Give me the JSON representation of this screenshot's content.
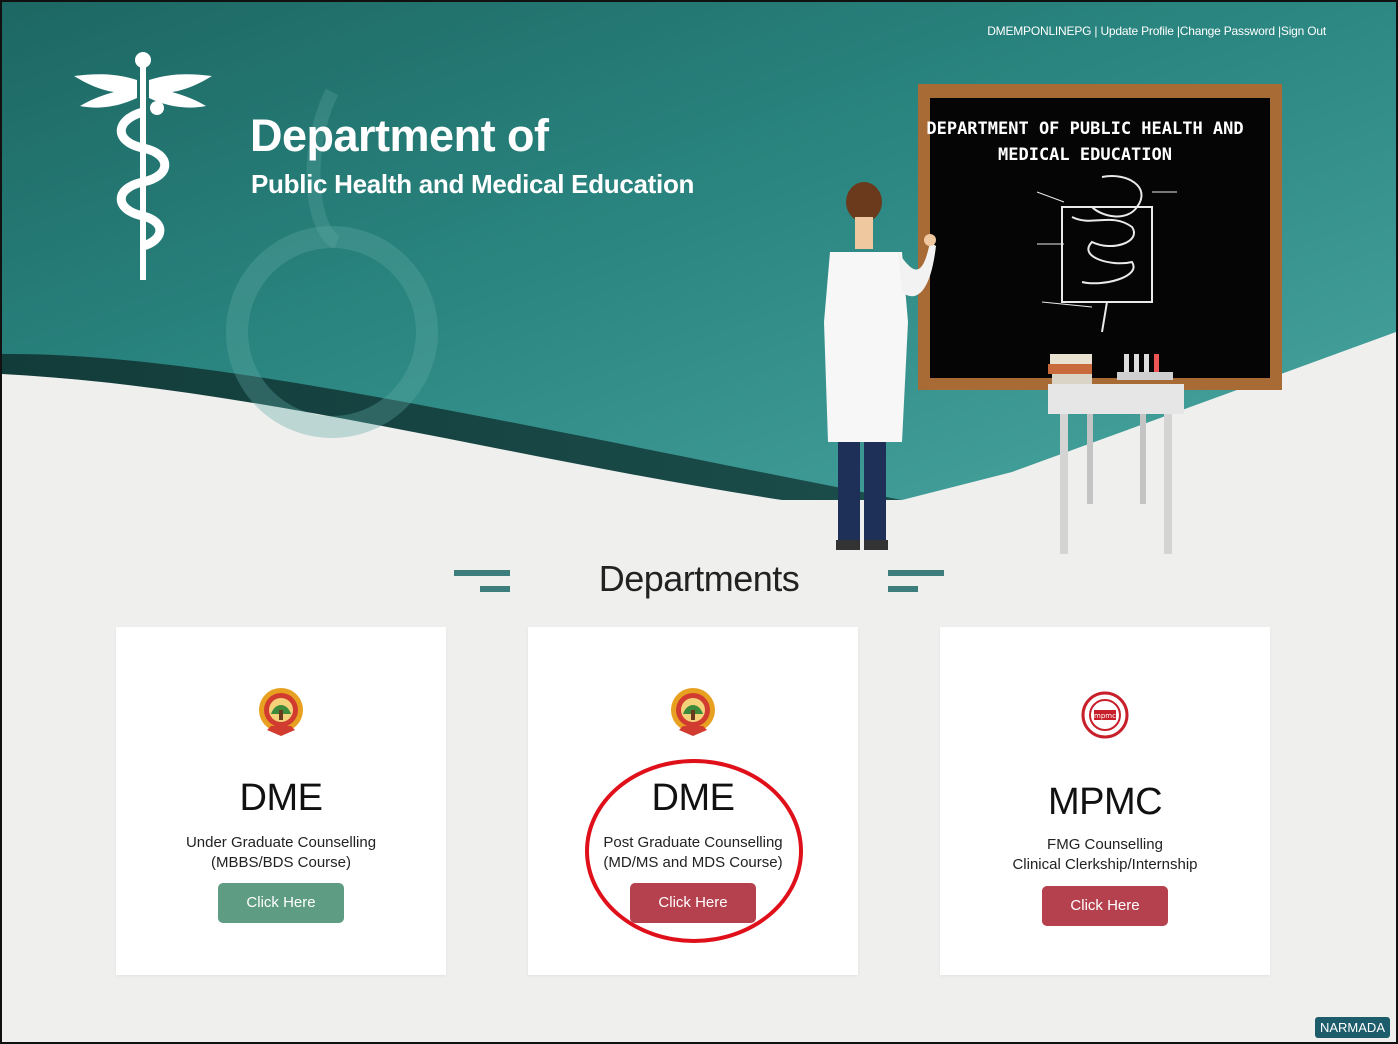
{
  "header": {
    "title": "Department of",
    "subtitle": "Public Health and Medical Education",
    "user_links": {
      "username": "DMEMPONLINEPG",
      "separator1": " | ",
      "update_profile": "Update Profile",
      "separator2": " |",
      "change_password": "Change Password",
      "separator3": " |",
      "sign_out": "Sign Out"
    },
    "blackboard": {
      "line1": "DEPARTMENT OF PUBLIC HEALTH AND",
      "line2": "MEDICAL EDUCATION"
    }
  },
  "section": {
    "title": "Departments"
  },
  "cards": [
    {
      "name": "DME",
      "desc_line1": "Under Graduate Counselling",
      "desc_line2": "(MBBS/BDS Course)",
      "button": "Click Here",
      "button_color": "#5e9c84",
      "emblem": "mp-govt-emblem-icon"
    },
    {
      "name": "DME",
      "desc_line1": "Post Graduate Counselling",
      "desc_line2": "(MD/MS and MDS Course)",
      "button": "Click Here",
      "button_color": "#b5414e",
      "emblem": "mp-govt-emblem-icon"
    },
    {
      "name": "MPMC",
      "desc_line1": "FMG Counselling",
      "desc_line2": "Clinical Clerkship/Internship",
      "button": "Click Here",
      "button_color": "#b5414e",
      "emblem": "mpmc-seal-icon"
    }
  ],
  "footer": {
    "badge": "NARMADA"
  },
  "colors": {
    "header_teal": "#1f6f6b",
    "accent_bar": "#3d7e7d",
    "annotation_red": "#e0101a"
  }
}
